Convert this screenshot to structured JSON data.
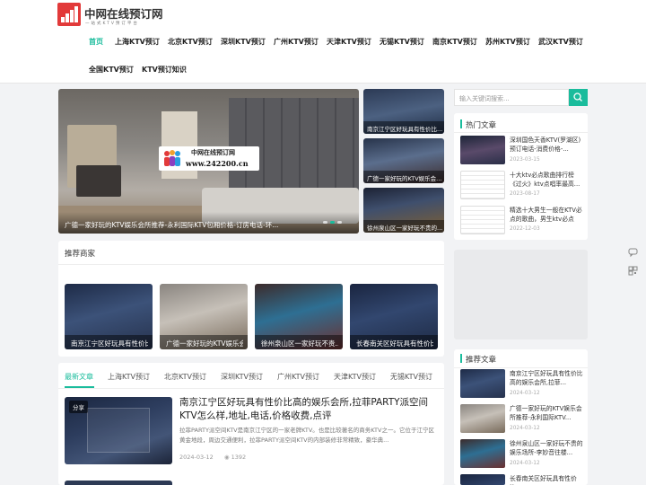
{
  "site": {
    "logo_title": "中网在线预订网",
    "logo_subtitle": "一站式KTV预订平台"
  },
  "nav": {
    "items": [
      {
        "label": "首页",
        "active": true
      },
      {
        "label": "上海KTV预订"
      },
      {
        "label": "北京KTV预订"
      },
      {
        "label": "深圳KTV预订"
      },
      {
        "label": "广州KTV预订"
      },
      {
        "label": "天津KTV预订"
      },
      {
        "label": "无锡KTV预订"
      },
      {
        "label": "南京KTV预订"
      },
      {
        "label": "苏州KTV预订"
      },
      {
        "label": "武汉KTV预订"
      },
      {
        "label": "全国KTV预订"
      },
      {
        "label": "KTV预订知识"
      }
    ]
  },
  "slider": {
    "caption": "广德一家好玩的KTV娱乐会所推荐-永利国际KTV包厢价格-订房电话-环...",
    "watermark_name": "中网在线预订网",
    "watermark_url": "www.242200.cn"
  },
  "side_thumbs": [
    {
      "caption": "南京江宁区好玩具有性价比..."
    },
    {
      "caption": "广德一家好玩的KTV娱乐会..."
    },
    {
      "caption": "徐州泉山区一家好玩不贵的..."
    }
  ],
  "merchants": {
    "title": "推荐商家",
    "items": [
      {
        "caption": "南京江宁区好玩具有性价比..."
      },
      {
        "caption": "广德一家好玩的KTV娱乐会..."
      },
      {
        "caption": "徐州泉山区一家好玩不贵..."
      },
      {
        "caption": "长春南关区好玩具有性价比..."
      }
    ]
  },
  "tabs": [
    {
      "label": "最新文章",
      "active": true
    },
    {
      "label": "上海KTV预订"
    },
    {
      "label": "北京KTV预订"
    },
    {
      "label": "深圳KTV预订"
    },
    {
      "label": "广州KTV预订"
    },
    {
      "label": "天津KTV预订"
    },
    {
      "label": "无锡KTV预订"
    }
  ],
  "article": {
    "badge": "分享",
    "title": "南京江宁区好玩具有性价比高的娱乐会所,拉菲PARTY派空间KTV怎么样,地址,电话,价格收费,点评",
    "desc": "拉菲PARTY派空间KTV是南京江宁区的一家老牌KTV。也是比较著名的商务KTV之一。它位于江宁区黄金地段，周边交通便利，拉菲PARTY派空间KTV的内部装修非常精致，豪华典...",
    "date": "2024-03-12",
    "views": "1392"
  },
  "search": {
    "placeholder": "输入关键词搜索..."
  },
  "hot": {
    "title": "热门文章",
    "items": [
      {
        "title": "深圳国色天香KTV(罗湖区)预订电话-消费价格-...",
        "date": "2023-03-15"
      },
      {
        "title": "十大ktv必点歌曲排行榜《过火》ktv点唱率最高...",
        "date": "2023-08-17"
      },
      {
        "title": "精选十大男生一般在KTV必点的歌曲，男生ktv必点",
        "date": "2022-12-03"
      }
    ]
  },
  "recommend": {
    "title": "推荐文章",
    "items": [
      {
        "title": "南京江宁区好玩具有性价比高的娱乐会所,拉菲...",
        "date": "2024-03-12"
      },
      {
        "title": "广德一家好玩的KTV娱乐会所推荐-永利国际KTV...",
        "date": "2024-03-12"
      },
      {
        "title": "徐州泉山区一家好玩不贵的娱乐场所-李妙音往楼...",
        "date": "2024-03-12"
      },
      {
        "title": "长春南关区好玩具有性价比...",
        "date": ""
      }
    ]
  },
  "colors": {
    "accent": "#1abc9c",
    "logo_red": "#e23a3a"
  }
}
